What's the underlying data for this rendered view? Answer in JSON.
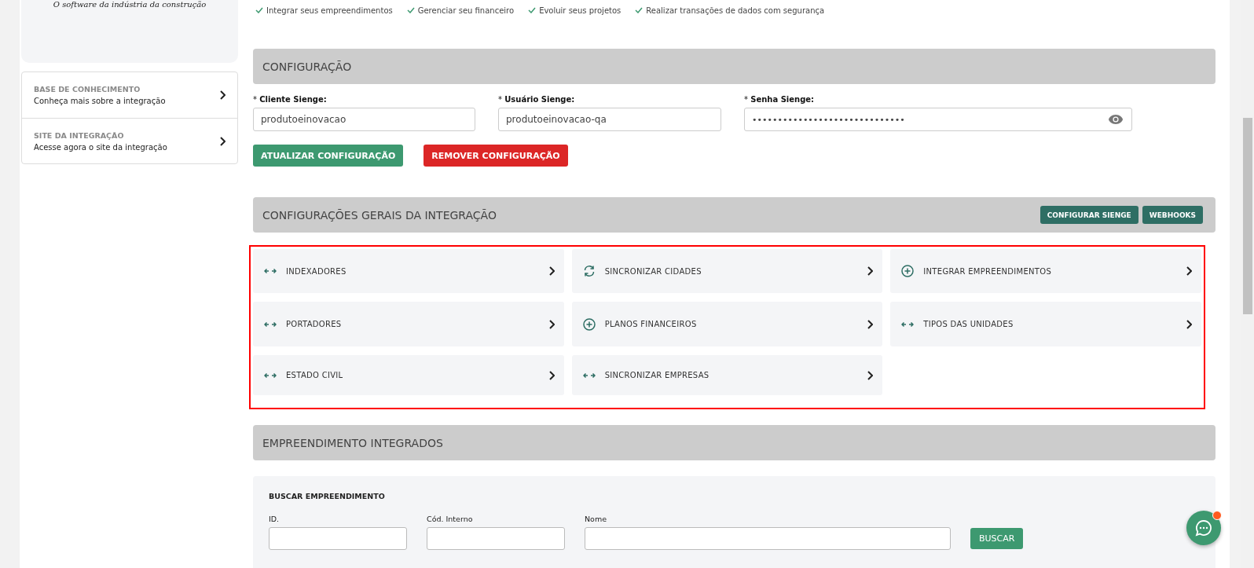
{
  "sidebar": {
    "tagline": "O software da indústria da construção",
    "links": [
      {
        "title": "BASE DE CONHECIMENTO",
        "subtitle": "Conheça mais sobre a integração"
      },
      {
        "title": "SITE DA INTEGRAÇÃO",
        "subtitle": "Acesse agora o site da integração"
      }
    ]
  },
  "benefits": [
    "Integrar seus empreendimentos",
    "Gerenciar seu financeiro",
    "Evoluir seus projetos",
    "Realizar transações de dados com segurança"
  ],
  "configuration": {
    "title": "CONFIGURAÇÃO",
    "fields": [
      {
        "label": "* **Cliente Sienge:**",
        "value": "produtoeinovacao",
        "kind": "text"
      },
      {
        "label": "* **Usuário Sienge:**",
        "value": "produtoeinovacao-qa",
        "kind": "text"
      },
      {
        "label": "* **Senha Sienge:**",
        "value": "••••••••••••••••••••••••••••••",
        "kind": "password"
      }
    ],
    "buttons": [
      {
        "label": "ATUALIZAR CONFIGURAÇÃO",
        "kind": "primary"
      },
      {
        "label": "REMOVER CONFIGURAÇÃO",
        "kind": "danger"
      }
    ]
  },
  "integration": {
    "title": "CONFIGURAÇÕES GERAIS DA INTEGRAÇÃO",
    "actions": [
      "CONFIGURAR SIENGE",
      "WEBHOOKS"
    ],
    "highlighted": true,
    "items": [
      {
        "label": "INDEXADORES",
        "kind": "exchange"
      },
      {
        "label": "SINCRONIZAR CIDADES",
        "kind": "sync"
      },
      {
        "label": "INTEGRAR EMPREENDIMENTOS",
        "kind": "add"
      },
      {
        "label": "PORTADORES",
        "kind": "exchange"
      },
      {
        "label": "PLANOS FINANCEIROS",
        "kind": "add"
      },
      {
        "label": "TIPOS DAS UNIDADES",
        "kind": "exchange"
      },
      {
        "label": "ESTADO CIVIL",
        "kind": "exchange"
      },
      {
        "label": "SINCRONIZAR EMPRESAS",
        "kind": "exchange"
      }
    ]
  },
  "projects": {
    "title": "EMPREENDIMENTO INTEGRADOS",
    "search": {
      "title": "BUSCAR EMPREENDIMENTO",
      "fields": [
        {
          "label": "ID."
        },
        {
          "label": "Cód. Interno"
        },
        {
          "label": "Nome"
        }
      ],
      "button": "BUSCAR"
    }
  },
  "chat": {
    "unread": true
  }
}
